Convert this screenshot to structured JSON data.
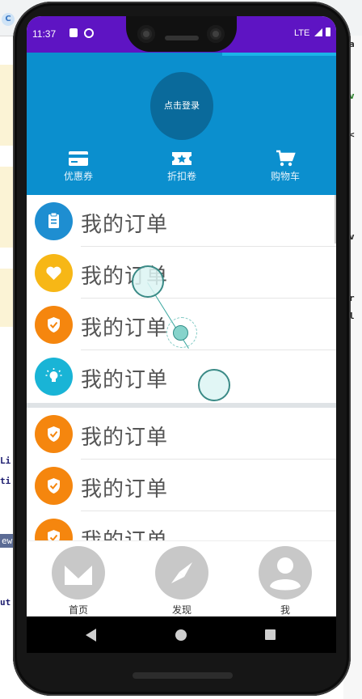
{
  "status_bar": {
    "time": "11:37",
    "network": "LTE"
  },
  "header": {
    "login_label": "点击登录",
    "quick_actions": [
      {
        "label": "优惠券",
        "icon": "card-icon"
      },
      {
        "label": "折扣卷",
        "icon": "ticket-icon"
      },
      {
        "label": "购物车",
        "icon": "cart-icon"
      }
    ]
  },
  "list": {
    "items": [
      {
        "label": "我的订单",
        "icon": "clipboard-icon",
        "color": "#1e8ed1"
      },
      {
        "label": "我的订单",
        "icon": "heart-icon",
        "color": "#f7b716"
      },
      {
        "label": "我的订单",
        "icon": "shield-check-icon",
        "color": "#f5860e"
      },
      {
        "label": "我的订单",
        "icon": "lightbulb-icon",
        "color": "#19b4d6"
      },
      {
        "label": "我的订单",
        "icon": "shield-check-icon",
        "color": "#f5860e"
      },
      {
        "label": "我的订单",
        "icon": "shield-check-icon",
        "color": "#f5860e"
      },
      {
        "label": "我的订单",
        "icon": "shield-check-icon",
        "color": "#f5860e"
      }
    ]
  },
  "bottom_nav": [
    {
      "label": "首页",
      "icon": "gmail-m-icon"
    },
    {
      "label": "发现",
      "icon": "compass-icon"
    },
    {
      "label": "我",
      "icon": "person-icon"
    }
  ],
  "background_editor": {
    "fragments": [
      "Li",
      "ti",
      "ew",
      "ut"
    ],
    "right_fragments": [
      "a",
      "v",
      "<",
      "v",
      "r",
      "l"
    ]
  },
  "colors": {
    "status_bar": "#5e14c3",
    "header": "#0b8fce",
    "login_circle": "#0a6a9b"
  }
}
